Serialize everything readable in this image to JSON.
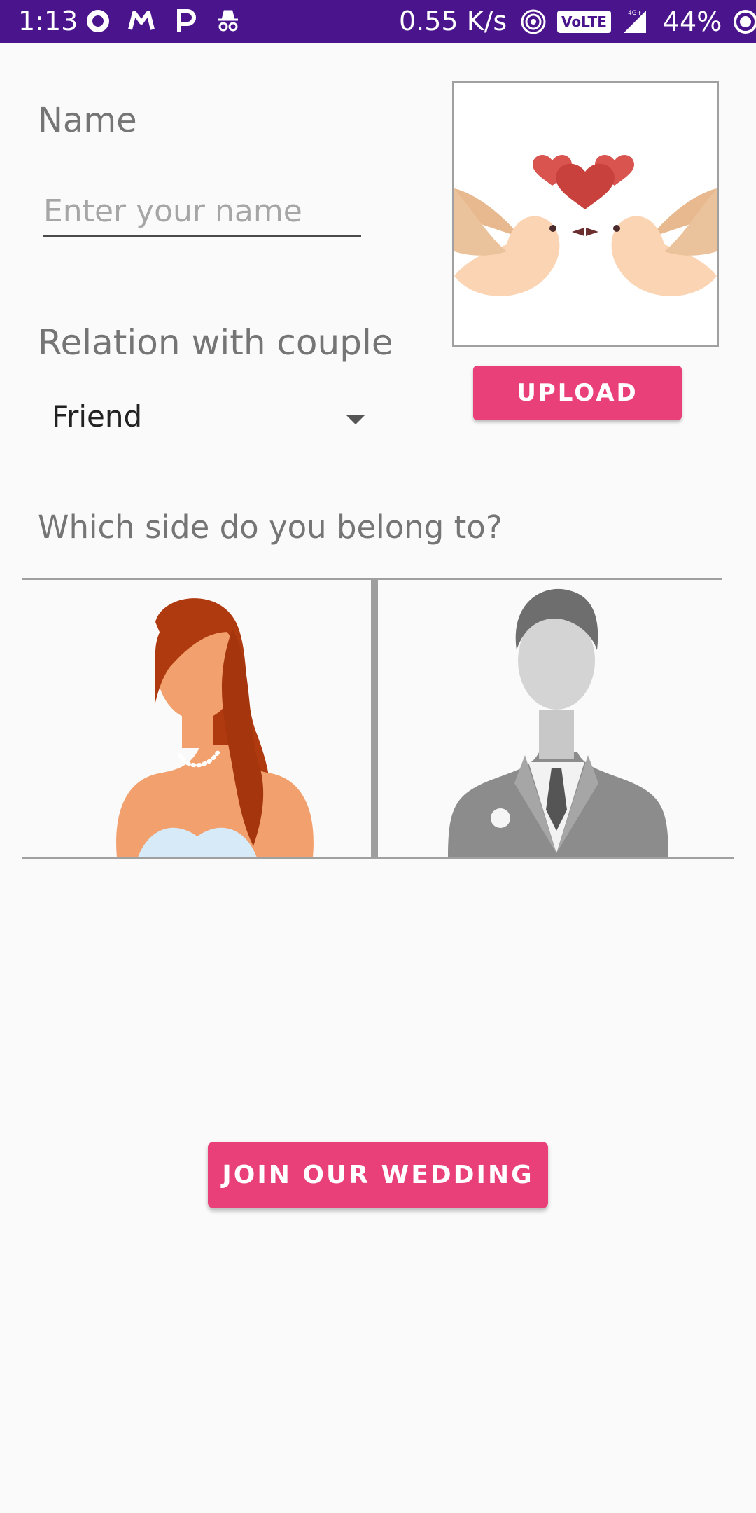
{
  "status_bar": {
    "time": "1:13",
    "speed": "0.55 K/s",
    "volte": "VoLTE",
    "network": "4G+",
    "battery": "44%"
  },
  "form": {
    "name_label": "Name",
    "name_placeholder": "Enter your name",
    "name_value": "",
    "relation_label": "Relation with couple",
    "relation_selected": "Friend",
    "upload_label": "UPLOAD",
    "side_label": "Which side do you belong to?",
    "side_options": [
      {
        "id": "bride",
        "icon": "bride-avatar-icon"
      },
      {
        "id": "groom",
        "icon": "groom-avatar-icon"
      }
    ],
    "join_label": "JOIN OUR WEDDING"
  },
  "colors": {
    "status_bar": "#4a148c",
    "accent": "#e94079",
    "label_gray": "#757575"
  }
}
